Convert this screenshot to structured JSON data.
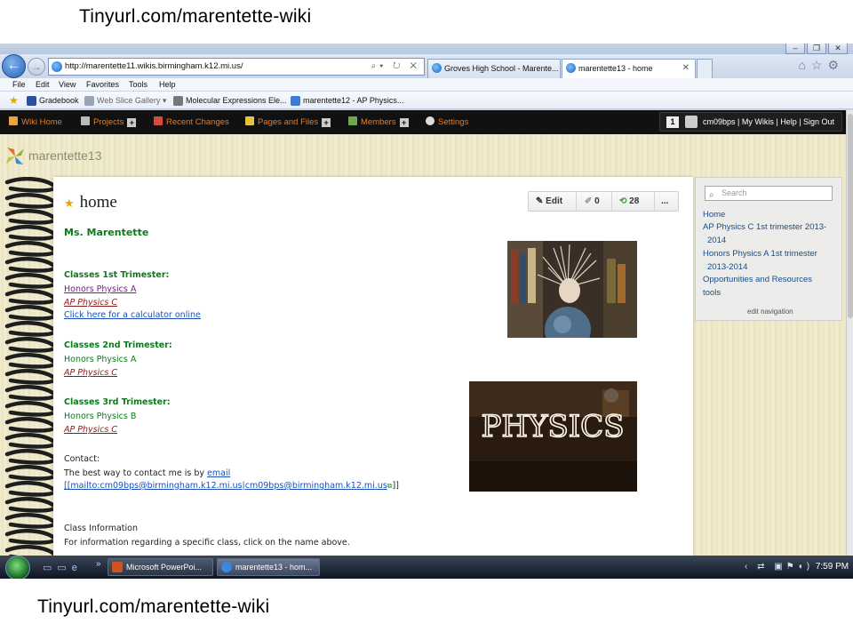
{
  "captions": {
    "top": "Tinyurl.com/marentette-wiki",
    "bottom": "Tinyurl.com/marentette-wiki"
  },
  "browser": {
    "address": "http://marentette11.wikis.birmingham.k12.mi.us/",
    "tabs": [
      {
        "label": "Groves High School - Marente...",
        "active": false
      },
      {
        "label": "marentette13 - home",
        "active": true
      }
    ],
    "menu": [
      "File",
      "Edit",
      "View",
      "Favorites",
      "Tools",
      "Help"
    ],
    "favorites": [
      {
        "label": "Gradebook",
        "icon": "gradebook-icon"
      },
      {
        "label": "Web Slice Gallery ▾",
        "icon": "web-slice-icon"
      },
      {
        "label": "Molecular Expressions Ele...",
        "icon": "page-icon"
      },
      {
        "label": "marentette12 - AP Physics...",
        "icon": "page-icon"
      }
    ]
  },
  "wiki": {
    "nav": [
      {
        "label": "Wiki Home",
        "icon": "home-icon",
        "plus": false
      },
      {
        "label": "Projects",
        "icon": "projects-icon",
        "plus": true
      },
      {
        "label": "Recent Changes",
        "icon": "calendar-icon",
        "plus": false
      },
      {
        "label": "Pages and Files",
        "icon": "pages-icon",
        "plus": true
      },
      {
        "label": "Members",
        "icon": "members-icon",
        "plus": true
      },
      {
        "label": "Settings",
        "icon": "gear-icon",
        "plus": false
      }
    ],
    "notification_count": "1",
    "user_links": "cm09bps | My Wikis | Help | Sign Out",
    "site_name": "marentette13",
    "page_title": "home",
    "toolbar": {
      "edit": "Edit",
      "comments": "0",
      "history": "28",
      "more": "..."
    },
    "content": {
      "heading": "Ms. Marentette",
      "t1_heading": "Classes 1st Trimester:",
      "t1_link1": "Honors Physics A",
      "t1_link2": "AP Physics C",
      "t1_link3": "Click here for a calculator online",
      "t2_heading": "Classes 2nd Trimester:",
      "t2_item1": "Honors Physics A",
      "t2_link1": "AP Physics C",
      "t3_heading": "Classes 3rd Trimester:",
      "t3_item1": "Honors Physics B",
      "t3_link1": "AP Physics C",
      "contact_heading": "Contact:",
      "contact_text": "The best way to contact me is by",
      "contact_link": "email",
      "mailto": "[[mailto:cm09bps@birmingham.k12.mi.us|cm09bps@birmingham.k12.mi.us",
      "mailto_end": "]]",
      "class_info_heading": "Class Information",
      "class_info_text": "For information regarding a specific class, click on the name above.",
      "image2_text": "PHYSICS"
    },
    "sidebar": {
      "search_placeholder": "Search",
      "links": [
        "Home",
        "AP Physics C 1st trimester 2013-",
        "2014",
        "Honors Physics A 1st trimester",
        "2013-2014",
        "Opportunities and Resources",
        "tools"
      ],
      "edit_navigation": "edit navigation"
    }
  },
  "taskbar": {
    "buttons": [
      {
        "label": "Microsoft PowerPoi...",
        "active": false
      },
      {
        "label": "marentette13 - hom...",
        "active": true
      }
    ],
    "clock": "7:59 PM"
  }
}
